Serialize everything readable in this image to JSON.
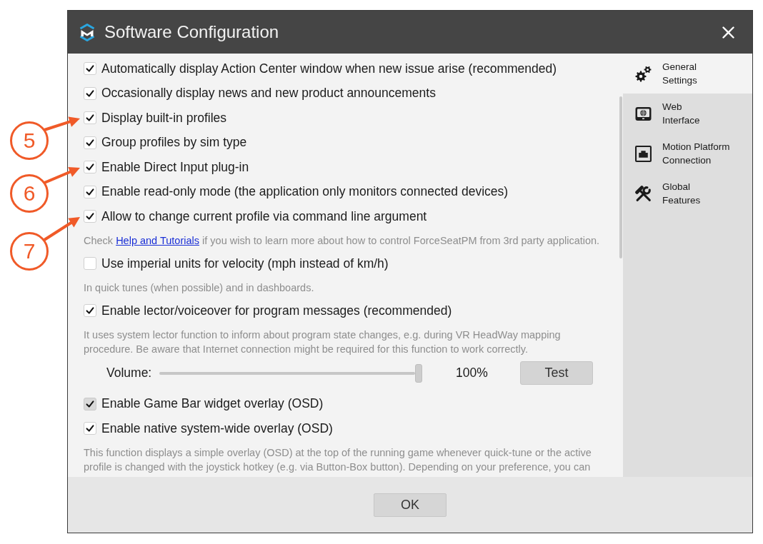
{
  "window": {
    "title": "Software Configuration"
  },
  "settings": [
    {
      "kind": "checkbox",
      "label": "Automatically display Action Center window when new issue arise (recommended)",
      "checked": true,
      "focused": false
    },
    {
      "kind": "checkbox",
      "label": "Occasionally display news and new product announcements",
      "checked": true,
      "focused": false
    },
    {
      "kind": "checkbox",
      "label": "Display built-in profiles",
      "checked": true,
      "focused": false,
      "callout": "5"
    },
    {
      "kind": "checkbox",
      "label": "Group profiles by sim type",
      "checked": true,
      "focused": false
    },
    {
      "kind": "checkbox",
      "label": "Enable Direct Input plug-in",
      "checked": true,
      "focused": false,
      "callout": "6"
    },
    {
      "kind": "checkbox",
      "label": "Enable read-only mode (the application only monitors connected devices)",
      "checked": true,
      "focused": false
    },
    {
      "kind": "checkbox",
      "label": "Allow to change current profile via command line argument",
      "checked": true,
      "focused": false,
      "callout": "7"
    },
    {
      "kind": "hint",
      "text": "Check ",
      "link": "Help and Tutorials",
      "text_after": " if you wish to learn more about how to control ForceSeatPM from 3rd party application."
    },
    {
      "kind": "checkbox",
      "label": "Use imperial units for velocity (mph instead of km/h)",
      "checked": false,
      "focused": false
    },
    {
      "kind": "hint",
      "text": "In quick tunes (when possible) and in dashboards."
    },
    {
      "kind": "checkbox",
      "label": "Enable lector/voiceover for program messages (recommended)",
      "checked": true,
      "focused": false
    },
    {
      "kind": "hint",
      "text": "It uses system lector function to inform about program state changes, e.g. during VR HeadWay mapping procedure. Be aware that Internet connection might be required for this function to work correctly."
    },
    {
      "kind": "slider",
      "label": "Volume:",
      "level": 1,
      "reading": "100%",
      "button": "Test"
    },
    {
      "kind": "checkbox",
      "label": "Enable Game Bar widget overlay (OSD)",
      "checked": true,
      "focused": true
    },
    {
      "kind": "checkbox",
      "label": "Enable native system-wide overlay (OSD)",
      "checked": true,
      "focused": false
    },
    {
      "kind": "hint",
      "text": "This function displays a simple overlay (OSD) at the top of the running game whenever quick-tune or the active profile is changed with the joystick hotkey (e.g. via Button-Box button). Depending on your preference, you can"
    }
  ],
  "sidebar": {
    "items": [
      {
        "lines": [
          "General",
          "Settings"
        ],
        "selected": true
      },
      {
        "lines": [
          "Web",
          "Interface"
        ],
        "selected": false
      },
      {
        "lines": [
          "Motion Platform",
          "Connection"
        ],
        "selected": false
      },
      {
        "lines": [
          "Global",
          "Features"
        ],
        "selected": false
      }
    ]
  },
  "footer": {
    "button": "OK"
  }
}
